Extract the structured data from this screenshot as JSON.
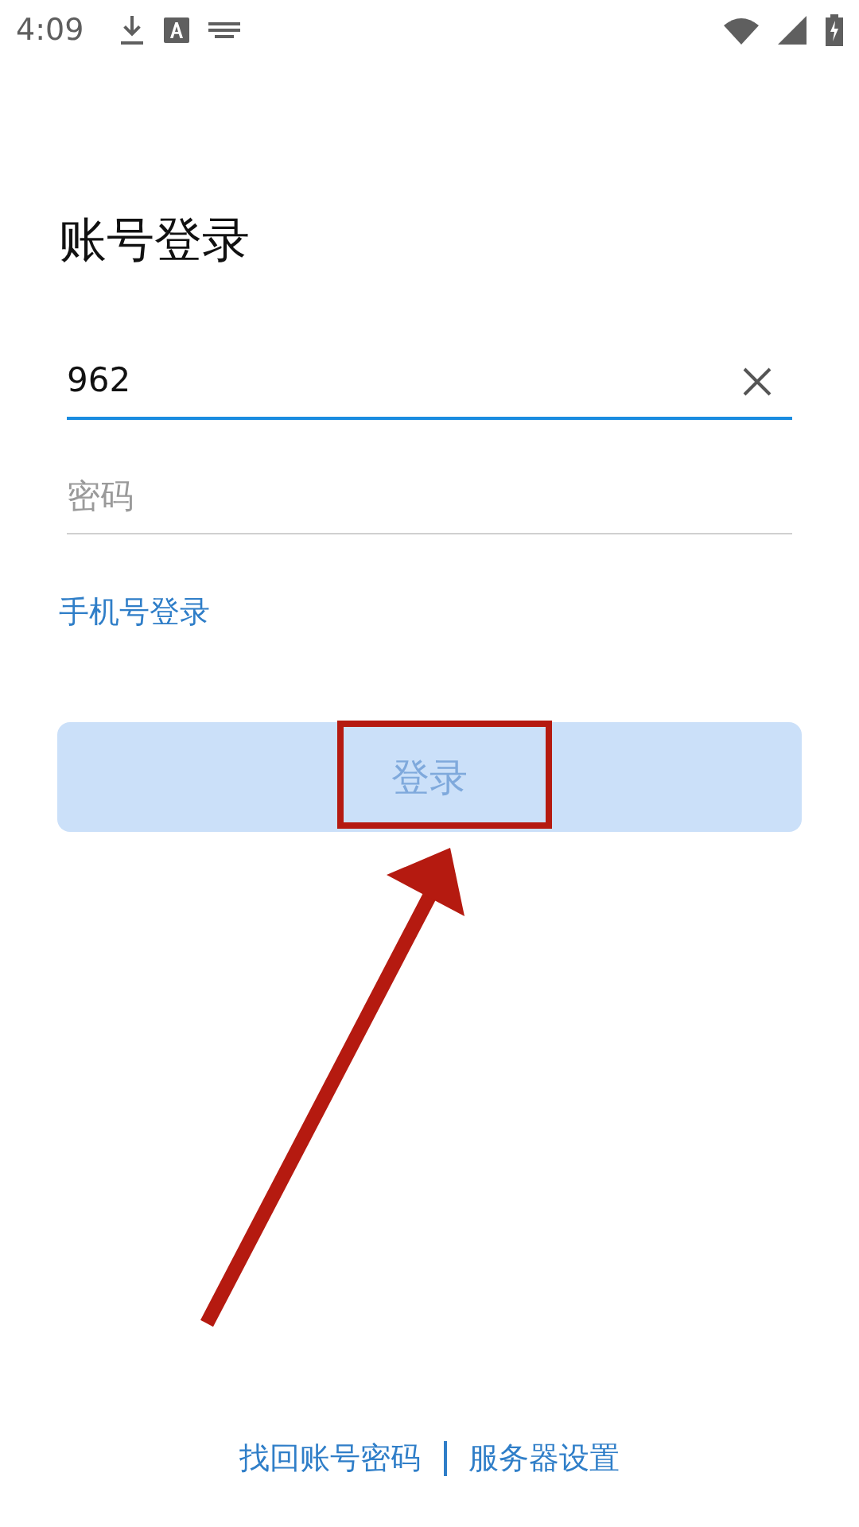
{
  "status_bar": {
    "time": "4:09"
  },
  "title": "账号登录",
  "account_field": {
    "value": "962"
  },
  "password_field": {
    "placeholder": "密码"
  },
  "phone_login_link": "手机号登录",
  "login_button": {
    "label": "登录",
    "disabled": true
  },
  "footer_links": [
    "找回账号密码",
    "服务器设置"
  ]
}
